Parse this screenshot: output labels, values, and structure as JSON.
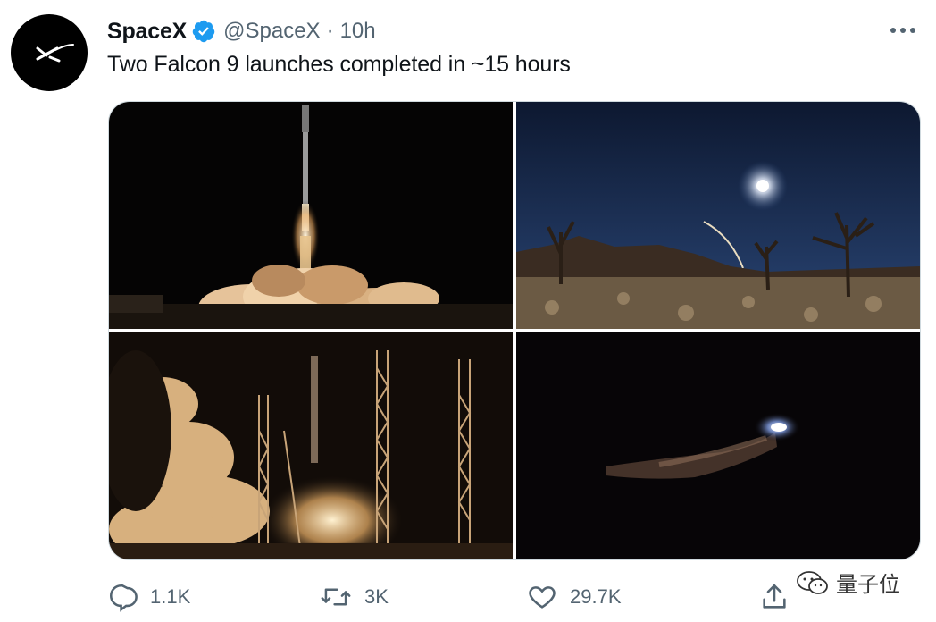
{
  "tweet": {
    "display_name": "SpaceX",
    "handle": "@SpaceX",
    "separator": "·",
    "time": "10h",
    "text": "Two Falcon 9 launches completed in ~15 hours",
    "verified": true
  },
  "media": {
    "photos": [
      {
        "subject": "rocket-liftoff-night"
      },
      {
        "subject": "desert-night-sky-with-streak"
      },
      {
        "subject": "launch-pad-towers-liftoff"
      },
      {
        "subject": "rocket-in-flight-night"
      }
    ]
  },
  "actions": {
    "reply_count": "1.1K",
    "retweet_count": "3K",
    "like_count": "29.7K"
  },
  "watermark": {
    "text": "量子位"
  },
  "colors": {
    "verified": "#1d9bf0",
    "secondary_text": "#536471",
    "border": "#cfd9de"
  }
}
